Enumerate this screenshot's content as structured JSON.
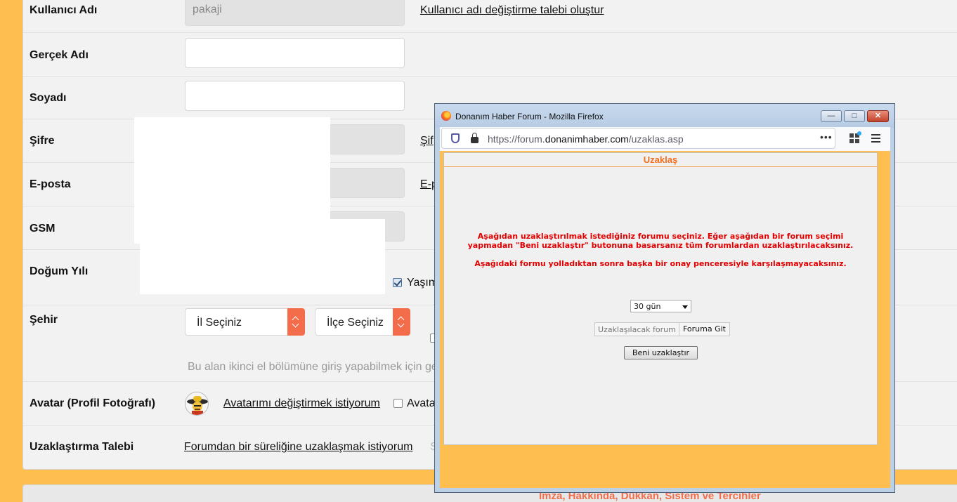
{
  "form": {
    "username": {
      "label": "Kullanıcı Adı",
      "value": "pakaji",
      "link": "Kullanıcı adı değiştirme talebi oluştur"
    },
    "realname": {
      "label": "Gerçek Adı"
    },
    "surname": {
      "label": "Soyadı"
    },
    "password": {
      "label": "Şifre",
      "link": "Şif"
    },
    "email": {
      "label": "E-posta",
      "link": "E-p"
    },
    "gsm": {
      "label": "GSM"
    },
    "birth_year": {
      "label": "Doğum Yılı",
      "checkbox_label": "Yaşım"
    },
    "city": {
      "label": "Şehir",
      "province": "İl Seçiniz",
      "district": "İlçe Seçiniz",
      "hint": "Bu alan ikinci el bölümüne giriş yapabilmek için ge"
    },
    "avatar": {
      "label": "Avatar (Profil Fotoğrafı)",
      "link": "Avatarımı değiştirmek istiyorum",
      "checkbox_label": "Avata"
    },
    "ban": {
      "label": "Uzaklaştırma Talebi",
      "link": "Forumdan bir süreliğine uzaklaşmak istiyorum",
      "trailing": "S"
    }
  },
  "footer": {
    "text": "İmza, Hakkında, Dükkan, Sistem ve Tercihler"
  },
  "popup": {
    "window_title": "Donanım Haber Forum - Mozilla Firefox",
    "url_prefix": "https://forum.",
    "url_domain": "donanimhaber.com",
    "url_path": "/uzaklas.asp",
    "page_title": "Uzaklaş",
    "message_line1": "Aşağıdan uzaklaştırılmak istediğiniz forumu seçiniz. Eğer aşağıdan bir forum seçimi",
    "message_line2": "yapmadan \"Beni uzaklaştır\" butonuna basarsanız tüm forumlardan uzaklaştırılacaksınız.",
    "message_line3": "Aşağıdaki formu yolladıktan sonra başka bir onay penceresiyle karşılaşmayacaksınız.",
    "duration_selected": "30 gün",
    "forum_placeholder": "Uzaklaşılacak forum",
    "goto_button": "Foruma Git",
    "ban_button": "Beni uzaklaştır"
  },
  "colors": {
    "accent": "#ffbf50",
    "orange": "#f46d4a",
    "error_red": "#e30000"
  }
}
